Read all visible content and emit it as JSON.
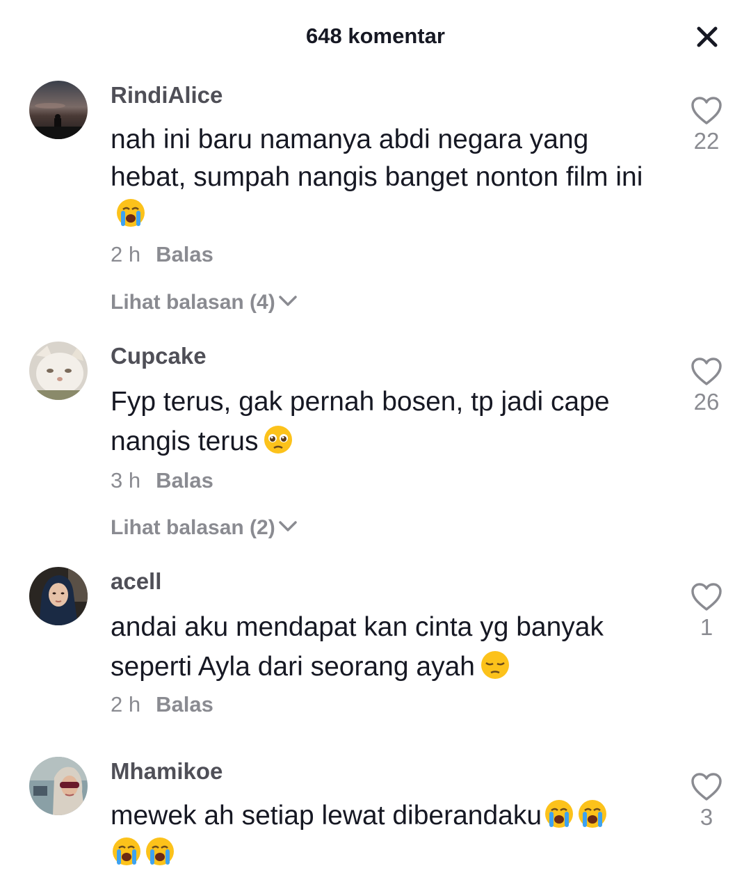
{
  "header": {
    "title": "648 komentar",
    "close_icon": "close-icon"
  },
  "comments": [
    {
      "username": "RindiAlice",
      "text": "nah ini baru namanya abdi negara yang hebat, sumpah nangis banget nonton film ini",
      "emojis": [
        "loudly-crying-face-emoji"
      ],
      "time": "2 h",
      "reply_label": "Balas",
      "view_replies": "Lihat balasan (4)",
      "likes": "22"
    },
    {
      "username": "Cupcake",
      "text": "Fyp terus, gak pernah bosen, tp jadi cape nangis terus",
      "emojis": [
        "pleading-face-emoji"
      ],
      "time": "3 h",
      "reply_label": "Balas",
      "view_replies": "Lihat balasan (2)",
      "likes": "26"
    },
    {
      "username": "acell",
      "text": "andai aku mendapat kan cinta yg banyak seperti Ayla dari seorang ayah",
      "emojis": [
        "pensive-face-emoji"
      ],
      "time": "2 h",
      "reply_label": "Balas",
      "likes": "1"
    },
    {
      "username": "Mhamikoe",
      "text": "mewek ah setiap lewat diberandaku",
      "emojis": [
        "loudly-crying-face-emoji",
        "loudly-crying-face-emoji",
        "loudly-crying-face-emoji",
        "loudly-crying-face-emoji"
      ],
      "likes": "3"
    }
  ]
}
